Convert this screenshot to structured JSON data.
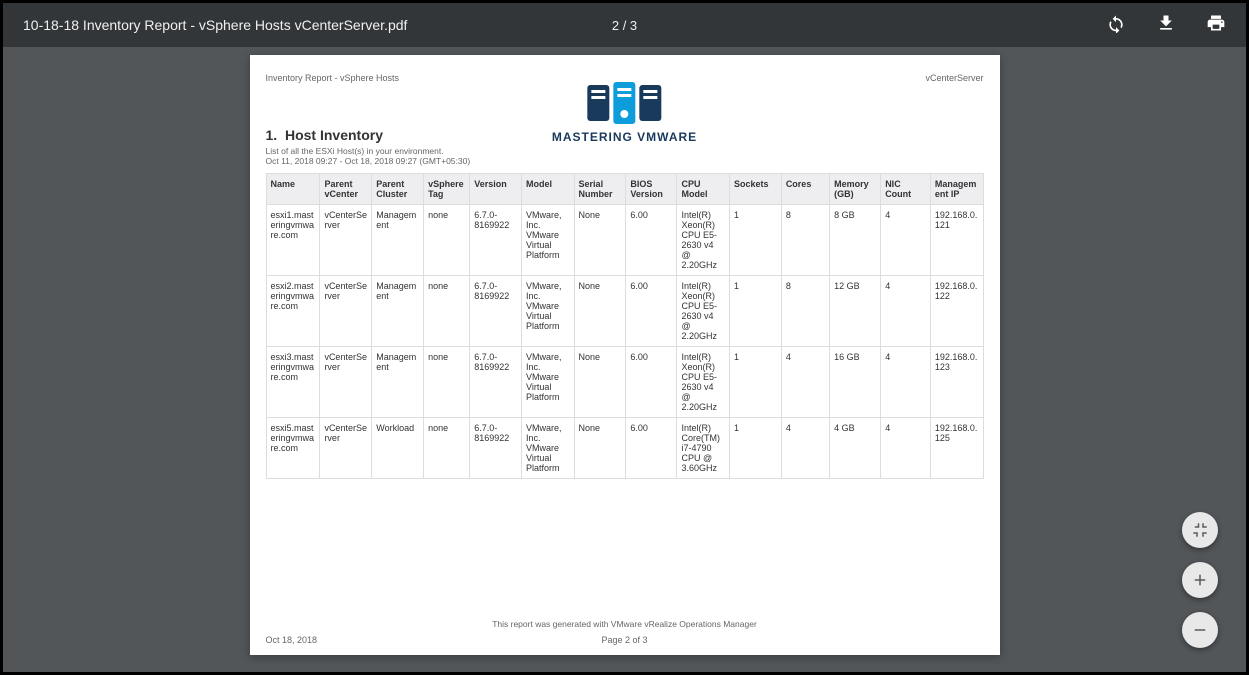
{
  "toolbar": {
    "doc_title": "10-18-18 Inventory Report - vSphere Hosts vCenterServer.pdf",
    "page_indicator": "2 / 3",
    "icons": {
      "rotate": "rotate-icon",
      "download": "download-icon",
      "print": "print-icon"
    }
  },
  "page_header": {
    "left": "Inventory Report - vSphere Hosts",
    "right": "vCenterServer"
  },
  "logo_text": "MASTERING VMWARE",
  "section": {
    "number": "1.",
    "title": "Host Inventory",
    "description": "List of all the ESXi Host(s) in your environment.",
    "dates": "Oct 11, 2018 09:27 - Oct 18, 2018 09:27 (GMT+05:30)"
  },
  "table": {
    "headers": [
      "Name",
      "Parent vCenter",
      "Parent Cluster",
      "vSphere Tag",
      "Version",
      "Model",
      "Serial Number",
      "BIOS Version",
      "CPU Model",
      "Sockets",
      "Cores",
      "Memory (GB)",
      "NIC Count",
      "Management IP"
    ],
    "col_widths": [
      "7.6%",
      "7.3%",
      "7.3%",
      "6.5%",
      "7.3%",
      "7.4%",
      "7.3%",
      "7.2%",
      "7.4%",
      "7.3%",
      "6.8%",
      "7.2%",
      "7%",
      "7.4%"
    ],
    "rows": [
      [
        "esxi1.masteringvmware.com",
        "vCenterServer",
        "Management",
        "none",
        "6.7.0-8169922",
        "VMware, Inc. VMware Virtual Platform",
        "None",
        "6.00",
        "Intel(R) Xeon(R) CPU E5-2630 v4 @ 2.20GHz",
        "1",
        "8",
        "8 GB",
        "4",
        "192.168.0.121"
      ],
      [
        "esxi2.masteringvmware.com",
        "vCenterServer",
        "Management",
        "none",
        "6.7.0-8169922",
        "VMware, Inc. VMware Virtual Platform",
        "None",
        "6.00",
        "Intel(R) Xeon(R) CPU E5-2630 v4 @ 2.20GHz",
        "1",
        "8",
        "12 GB",
        "4",
        "192.168.0.122"
      ],
      [
        "esxi3.masteringvmware.com",
        "vCenterServer",
        "Management",
        "none",
        "6.7.0-8169922",
        "VMware, Inc. VMware Virtual Platform",
        "None",
        "6.00",
        "Intel(R) Xeon(R) CPU E5-2630 v4 @ 2.20GHz",
        "1",
        "4",
        "16 GB",
        "4",
        "192.168.0.123"
      ],
      [
        "esxi5.masteringvmware.com",
        "vCenterServer",
        "Workload",
        "none",
        "6.7.0-8169922",
        "VMware, Inc. VMware Virtual Platform",
        "None",
        "6.00",
        "Intel(R) Core(TM) i7-4790 CPU @ 3.60GHz",
        "1",
        "4",
        "4 GB",
        "4",
        "192.168.0.125"
      ]
    ]
  },
  "report_note": "This report was generated with VMware vRealize Operations Manager",
  "page_footer": {
    "left": "Oct 18, 2018",
    "center": "Page 2 of 3"
  },
  "float_controls": {
    "fit": "fit-to-page",
    "zoom_in": "+",
    "zoom_out": "−"
  }
}
